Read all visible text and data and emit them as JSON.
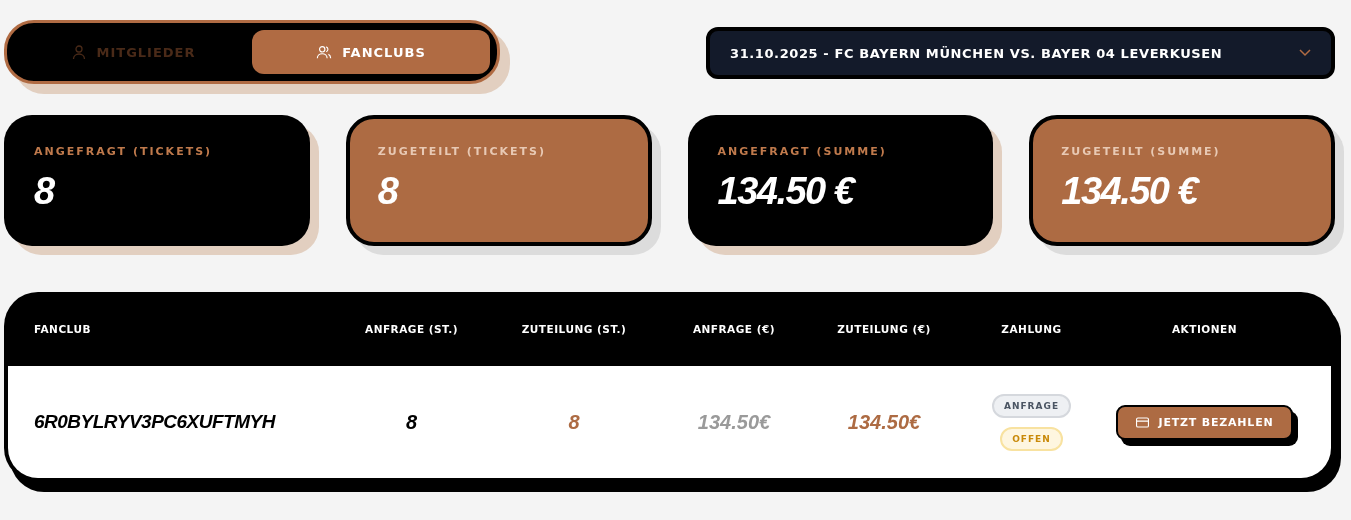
{
  "tabs": [
    {
      "label": "MITGLIEDER",
      "kind": "person",
      "selected": false
    },
    {
      "label": "FANCLUBS",
      "kind": "people",
      "selected": true
    }
  ],
  "match_select": {
    "value": "31.10.2025 - FC BAYERN MÜNCHEN VS. BAYER 04 LEVERKUSEN"
  },
  "stats": [
    {
      "label": "ANGEFRAGT (TICKETS)",
      "value": "8",
      "kind": "dark"
    },
    {
      "label": "ZUGETEILT (TICKETS)",
      "value": "8",
      "kind": "accent"
    },
    {
      "label": "ANGEFRAGT (SUMME)",
      "value": "134.50 €",
      "kind": "dark"
    },
    {
      "label": "ZUGETEILT (SUMME)",
      "value": "134.50 €",
      "kind": "accent"
    }
  ],
  "table": {
    "columns": [
      "FANCLUB",
      "ANFRAGE (ST.)",
      "ZUTEILUNG (ST.)",
      "ANFRAGE (€)",
      "ZUTEILUNG (€)",
      "ZAHLUNG",
      "AKTIONEN"
    ],
    "rows": [
      {
        "cells": [
          {
            "text": "6R0BYLRYV3PC6XUFTMYH",
            "kind": "name"
          },
          {
            "text": "8",
            "kind": "plain"
          },
          {
            "text": "8",
            "kind": "accent"
          },
          {
            "text": "134.50€",
            "kind": "muted"
          },
          {
            "text": "134.50€",
            "kind": "accent"
          },
          {
            "kind": "payment",
            "badges": [
              {
                "text": "ANFRAGE",
                "kind": "request"
              },
              {
                "text": "OFFEN",
                "kind": "open"
              }
            ]
          },
          {
            "kind": "action",
            "text": "JETZT BEZAHLEN"
          }
        ]
      }
    ]
  }
}
